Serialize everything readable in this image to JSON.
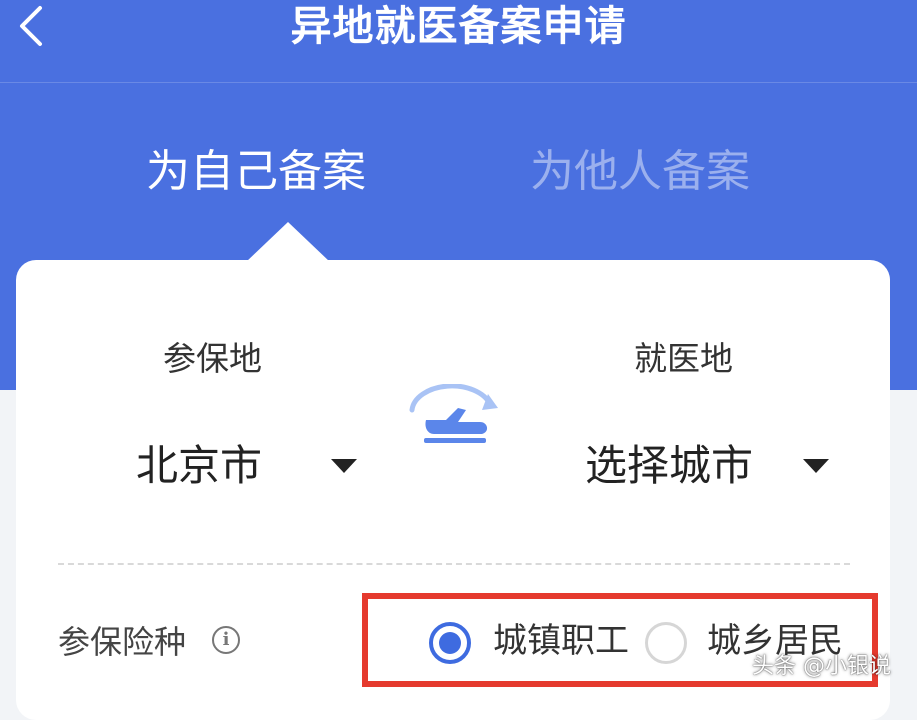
{
  "header": {
    "title": "异地就医备案申请",
    "back_icon": "chevron-left-icon"
  },
  "tabs": [
    {
      "label": "为自己备案",
      "active": true
    },
    {
      "label": "为他人备案",
      "active": false
    }
  ],
  "form": {
    "insured_place": {
      "label": "参保地",
      "value": "北京市"
    },
    "swap_icon": "plane-swap-icon",
    "treatment_place": {
      "label": "就医地",
      "value": "选择城市"
    },
    "insurance_type": {
      "label": "参保险种",
      "info_icon": "info-icon",
      "options": [
        {
          "label": "城镇职工",
          "selected": true
        },
        {
          "label": "城乡居民",
          "selected": false
        }
      ]
    }
  },
  "watermark": "头条 @小银说",
  "colors": {
    "primary": "#4a70e0",
    "radio_active": "#3e6be0",
    "highlight_box": "#e53a2e"
  }
}
